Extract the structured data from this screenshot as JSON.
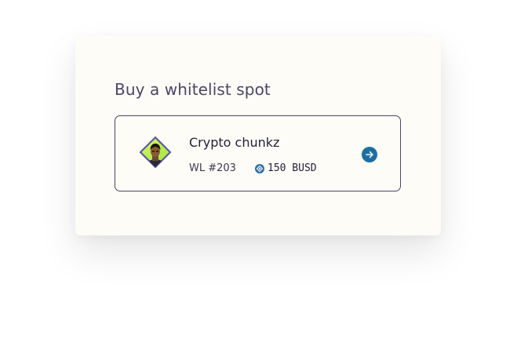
{
  "panel": {
    "title": "Buy a whitelist spot"
  },
  "listing": {
    "name": "Crypto chunkz",
    "whitelist_label": "WL #203",
    "price": "150 BUSD",
    "avatar_icon": "nft-character-avatar",
    "currency_icon": "busd-coin-icon",
    "action_icon": "arrow-right-icon"
  },
  "colors": {
    "panel_bg": "#fdfcf6",
    "title": "#4b4668",
    "card_border": "#4a4766",
    "accent": "#1c6fa1",
    "avatar_bg": "#b9ef4a"
  }
}
